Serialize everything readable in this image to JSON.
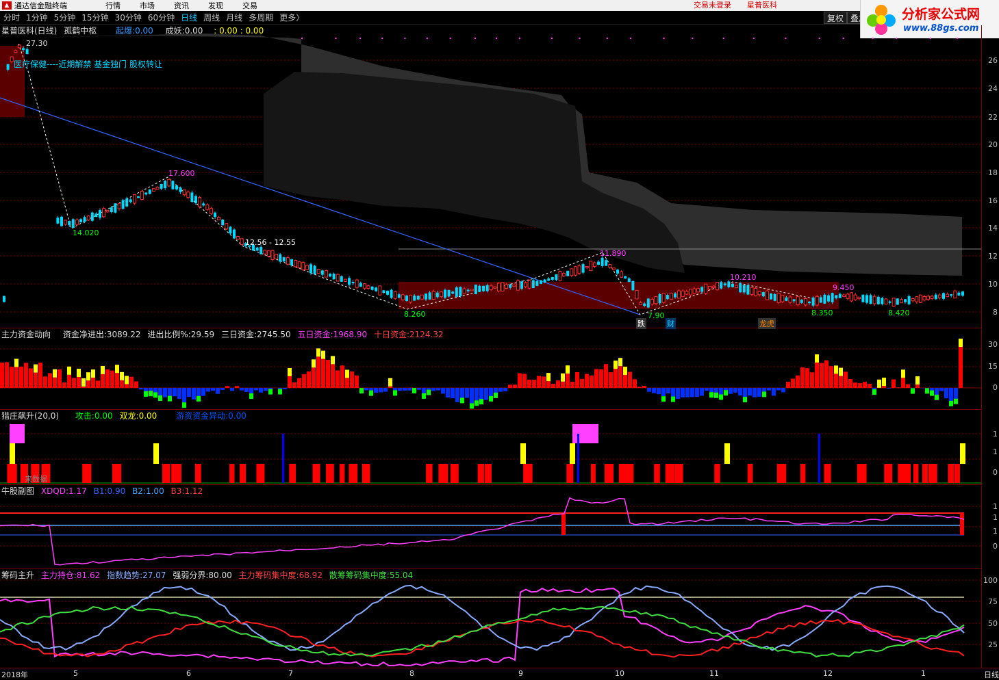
{
  "menubar": {
    "app_title": "通达信金融终端",
    "menu": [
      "行情",
      "市场",
      "资讯",
      "发现",
      "交易"
    ],
    "login_status": "交易未登录",
    "stock_name": "星普医科"
  },
  "toolbar": {
    "periods": [
      "分时",
      "1分钟",
      "5分钟",
      "15分钟",
      "30分钟",
      "60分钟",
      "日线",
      "周线",
      "月线",
      "多周期",
      "更多〉"
    ],
    "active_period": "日线",
    "right_buttons": [
      "复权",
      "叠加"
    ]
  },
  "watermark": {
    "title": "分析家公式网",
    "url": "www.88gs.com"
  },
  "main_panel": {
    "stock_title": "星普医科(日线)",
    "indicator": "孤鹤中枢",
    "qibao_label": "起爆:",
    "qibao_value": "0.00",
    "chengyao_label": "成妖:",
    "chengyao_value": "0.00",
    "extra_value": ": 0.00 : 0.00",
    "news_text": "医疗保健----近期解禁 基金独门 股权转让",
    "price_labels": [
      "27.30",
      "17.600",
      "14.020",
      "12.56 - 12.55",
      "11.890",
      "10.210",
      "9.450",
      "8.260",
      "8.350",
      "8.420",
      "7.90"
    ],
    "event_tags": [
      "跌",
      "财",
      "龙虎"
    ],
    "y_ticks": [
      "26",
      "24",
      "22",
      "20",
      "18",
      "16",
      "14",
      "12",
      "10",
      "8"
    ]
  },
  "fund_panel": {
    "title": "主力资金动向",
    "net_label": "资金净进出:",
    "net_value": "3089.22",
    "ratio_label": "进出比例%:",
    "ratio_value": "29.59",
    "three_day_label": "三日资金:",
    "three_day_value": "2745.50",
    "five_day_label": "五日资金:",
    "five_day_value": "1968.90",
    "ten_day_label": "十日资金:",
    "ten_day_value": "2124.32",
    "y_ticks": [
      "30",
      "15",
      "0"
    ]
  },
  "hunter_panel": {
    "title": "猎庄飙升(20,0)",
    "attack_label": "攻击:",
    "attack_value": "0.00",
    "dragon_label": "双龙:",
    "dragon_value": "0.00",
    "anomaly_label": "游资资金异动:",
    "anomaly_value": "0.00",
    "watermark_text": "来数据",
    "y_ticks": [
      "1",
      "1",
      "0"
    ]
  },
  "bull_panel": {
    "title": "牛股副图",
    "xdqd_label": "XDQD:",
    "xdqd_value": "1.17",
    "b1_label": "B1:",
    "b1_value": "0.90",
    "b2_label": "B2:",
    "b2_value": "1.00",
    "b3_label": "B3:",
    "b3_value": "1.12",
    "y_ticks": [
      "1",
      "1",
      "1",
      "0"
    ]
  },
  "chip_panel": {
    "title": "筹码主升",
    "main_hold_label": "主力持仓:",
    "main_hold_value": "81.62",
    "index_trend_label": "指数趋势:",
    "index_trend_value": "27.07",
    "strength_label": "强弱分界:",
    "strength_value": "80.00",
    "main_conc_label": "主力筹码集中度:",
    "main_conc_value": "68.92",
    "retail_conc_label": "散筹筹码集中度:",
    "retail_conc_value": "55.04",
    "y_ticks": [
      "100",
      "75",
      "50",
      "25"
    ]
  },
  "date_axis": {
    "labels": [
      "2018年",
      "5",
      "6",
      "7",
      "8",
      "9",
      "10",
      "11",
      "12",
      "1"
    ],
    "right_label": "日线"
  },
  "colors": {
    "up": "#ff3030",
    "down": "#00d8ff",
    "grid": "#800000",
    "fund_pos": "#ff0000",
    "fund_yellow": "#ffff00",
    "fund_neg": "#0030ff",
    "fund_green": "#00ff00",
    "magenta": "#ff40ff",
    "trend_line": "#3366ff"
  }
}
